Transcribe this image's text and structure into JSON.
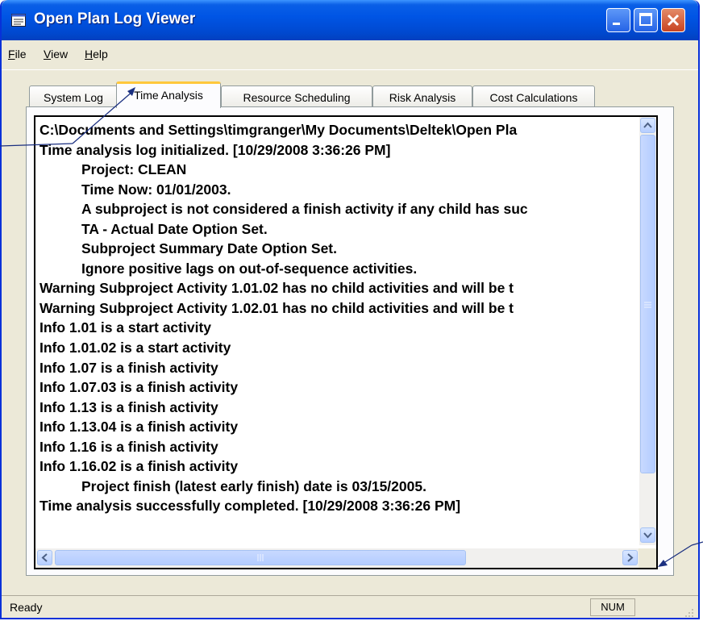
{
  "window": {
    "title": "Open Plan Log Viewer"
  },
  "menu": [
    {
      "prefix": "",
      "underline": "F",
      "rest": "ile"
    },
    {
      "prefix": "",
      "underline": "V",
      "rest": "iew"
    },
    {
      "prefix": "",
      "underline": "H",
      "rest": "elp"
    }
  ],
  "tabs": [
    "System Log",
    "Time Analysis",
    "Resource Scheduling",
    "Risk Analysis",
    "Cost Calculations"
  ],
  "active_tab": "Time Analysis",
  "log": {
    "lines": [
      "C:\\Documents and Settings\\timgranger\\My Documents\\Deltek\\Open Pla",
      "Time analysis log initialized.  [10/29/2008 3:36:26 PM]",
      "Project: CLEAN",
      "Time Now: 01/01/2003.",
      "A subproject is not considered a finish activity if any child has suc",
      "TA - Actual Date Option Set.",
      "Subproject Summary Date Option Set.",
      "Ignore positive lags on out-of-sequence activities.",
      "Warning Subproject Activity 1.01.02 has no child activities and will be t",
      "Warning Subproject Activity 1.02.01 has no child activities and will be t",
      "Info   1.01 is a start activity",
      "Info   1.01.02 is a start activity",
      "Info   1.07 is a finish activity",
      "Info   1.07.03 is a finish activity",
      "Info   1.13 is a finish activity",
      "Info   1.13.04 is a finish activity",
      "Info   1.16 is a finish activity",
      "Info   1.16.02 is a finish activity",
      "Project finish (latest early finish) date is 03/15/2005.",
      "Time analysis successfully completed.  [10/29/2008 3:36:26 PM]"
    ]
  },
  "statusbar": {
    "text": "Ready",
    "num": "NUM"
  },
  "colors": {
    "titlebar": "#0055e5",
    "active_tab_accent": "#ffc83c",
    "face": "#ece9d8"
  }
}
